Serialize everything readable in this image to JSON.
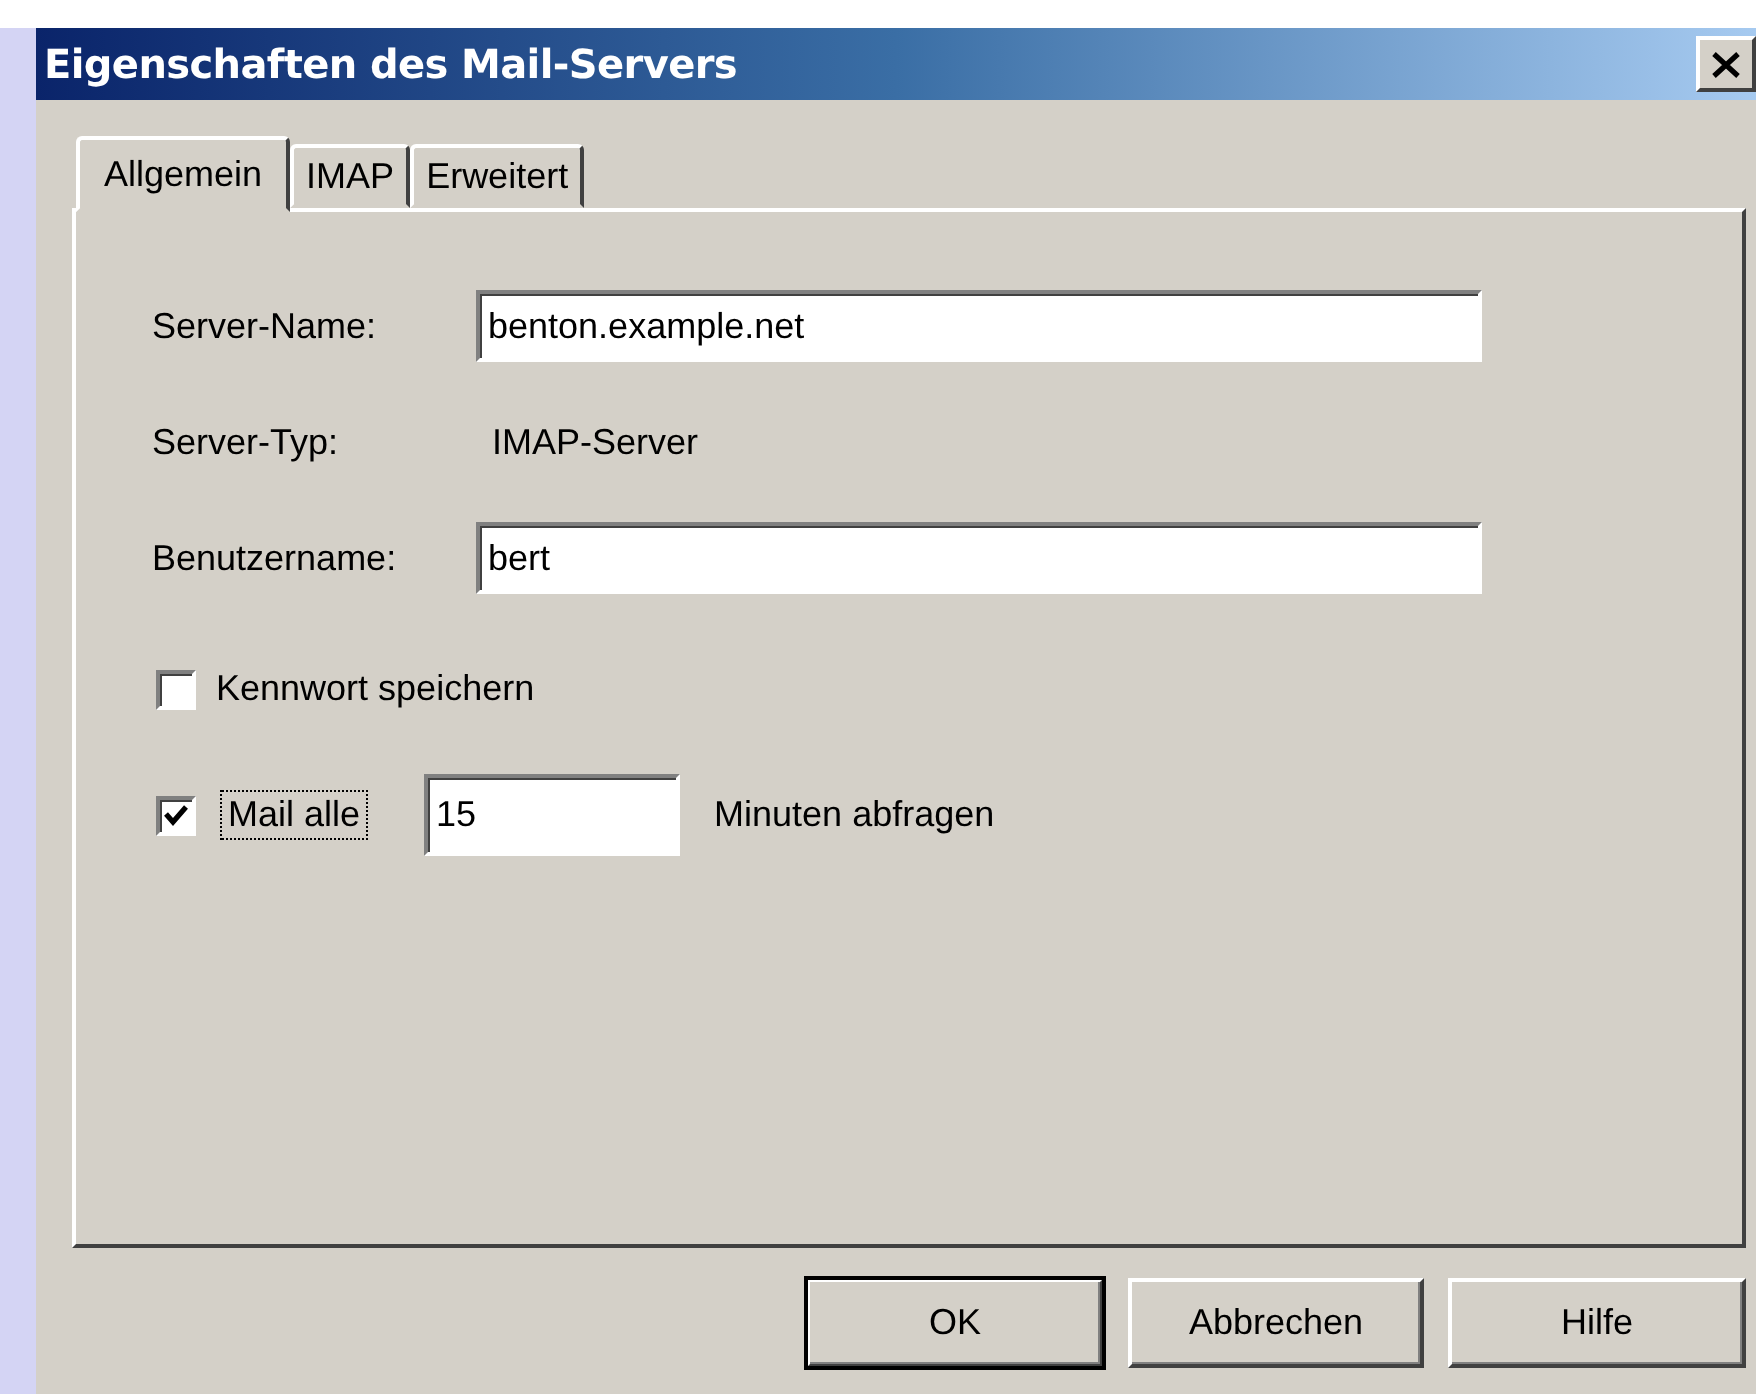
{
  "window": {
    "title": "Eigenschaften des Mail-Servers"
  },
  "tabs": [
    {
      "label": "Allgemein",
      "selected": true
    },
    {
      "label": "IMAP",
      "selected": false
    },
    {
      "label": "Erweitert",
      "selected": false
    }
  ],
  "fields": [
    {
      "kind": "input",
      "label": "Server-Name:",
      "value": "benton.example.net"
    },
    {
      "kind": "static",
      "label": "Server-Typ:",
      "value": "IMAP-Server"
    },
    {
      "kind": "input",
      "label": "Benutzername:",
      "value": "bert"
    }
  ],
  "save_password": {
    "label": "Kennwort speichern",
    "checked": false
  },
  "poll": {
    "label": "Mail alle",
    "checked": true,
    "value": "15",
    "suffix": "Minuten abfragen"
  },
  "buttons": [
    {
      "label": "OK",
      "default": true
    },
    {
      "label": "Abbrechen",
      "default": false
    },
    {
      "label": "Hilfe",
      "default": false
    }
  ]
}
